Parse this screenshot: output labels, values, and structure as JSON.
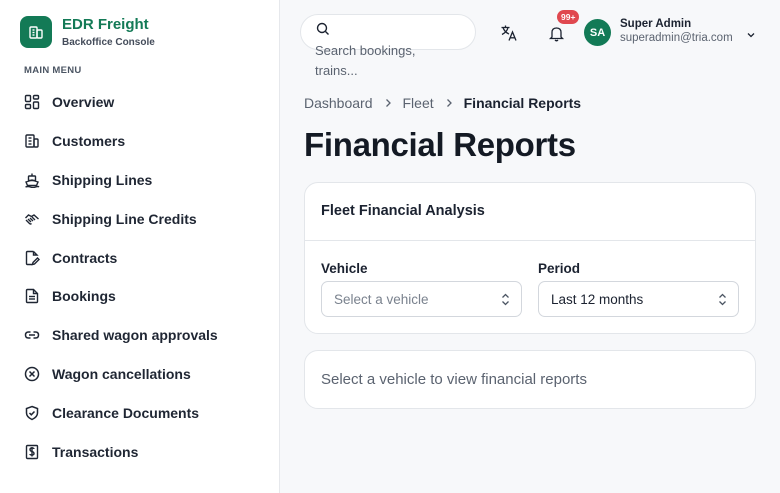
{
  "brand": {
    "title": "EDR Freight",
    "subtitle": "Backoffice Console",
    "logo_icon": "building-icon",
    "color": "#137a56"
  },
  "sidebar": {
    "section_label": "MAIN MENU",
    "items": [
      {
        "label": "Overview",
        "icon": "dashboard-grid-icon"
      },
      {
        "label": "Customers",
        "icon": "building-icon"
      },
      {
        "label": "Shipping Lines",
        "icon": "ship-icon"
      },
      {
        "label": "Shipping Line Credits",
        "icon": "handshake-icon"
      },
      {
        "label": "Contracts",
        "icon": "file-pen-icon"
      },
      {
        "label": "Bookings",
        "icon": "file-text-icon"
      },
      {
        "label": "Shared wagon approvals",
        "icon": "link-icon"
      },
      {
        "label": "Wagon cancellations",
        "icon": "circle-x-icon"
      },
      {
        "label": "Clearance Documents",
        "icon": "shield-check-icon"
      },
      {
        "label": "Transactions",
        "icon": "dollar-receipt-icon"
      }
    ]
  },
  "header": {
    "search_placeholder": "Search bookings, trains...",
    "notification_count": "99+",
    "user": {
      "initials": "SA",
      "name": "Super Admin",
      "email": "superadmin@tria.com"
    }
  },
  "breadcrumb": {
    "items": [
      "Dashboard",
      "Fleet"
    ],
    "current": "Financial Reports"
  },
  "page": {
    "title": "Financial Reports"
  },
  "analysis_card": {
    "title": "Fleet Financial Analysis",
    "vehicle": {
      "label": "Vehicle",
      "placeholder": "Select a vehicle"
    },
    "period": {
      "label": "Period",
      "value": "Last 12 months"
    }
  },
  "empty_state": {
    "message": "Select a vehicle to view financial reports"
  }
}
